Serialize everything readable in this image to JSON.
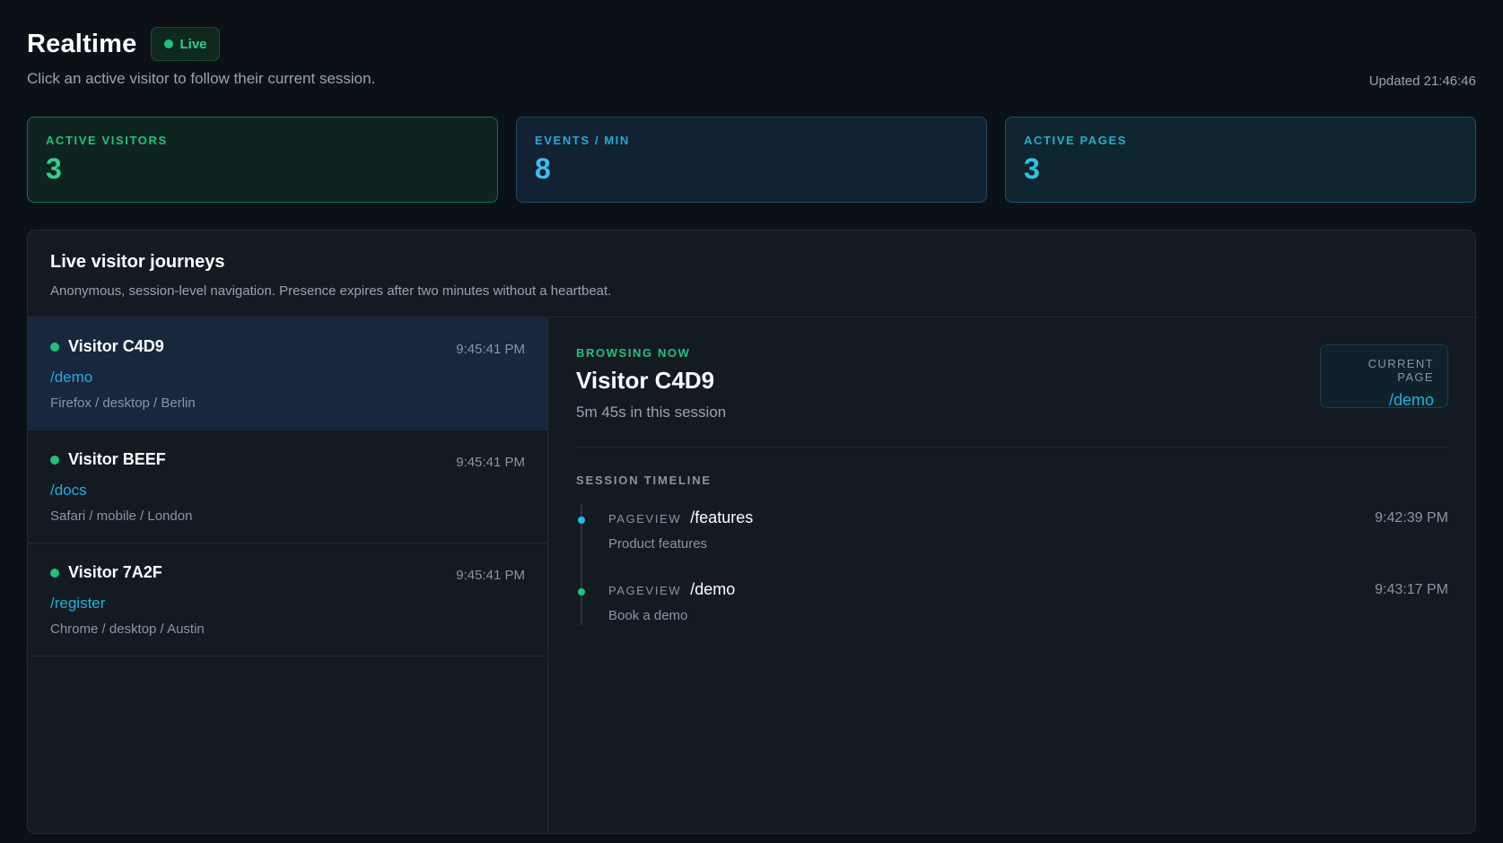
{
  "header": {
    "title": "Realtime",
    "live_badge": "Live",
    "subtitle": "Click an active visitor to follow their current session.",
    "updated": "Updated 21:46:46"
  },
  "stats": [
    {
      "label": "ACTIVE VISITORS",
      "value": "3"
    },
    {
      "label": "EVENTS / MIN",
      "value": "8"
    },
    {
      "label": "ACTIVE PAGES",
      "value": "3"
    }
  ],
  "panel": {
    "title": "Live visitor journeys",
    "description": "Anonymous, session-level navigation. Presence expires after two minutes without a heartbeat."
  },
  "visitors": [
    {
      "name": "Visitor C4D9",
      "time": "9:45:41 PM",
      "path": "/demo",
      "meta": "Firefox / desktop / Berlin",
      "selected": true
    },
    {
      "name": "Visitor BEEF",
      "time": "9:45:41 PM",
      "path": "/docs",
      "meta": "Safari / mobile / London",
      "selected": false
    },
    {
      "name": "Visitor 7A2F",
      "time": "9:45:41 PM",
      "path": "/register",
      "meta": "Chrome / desktop / Austin",
      "selected": false
    }
  ],
  "detail": {
    "status_label": "BROWSING NOW",
    "name": "Visitor C4D9",
    "duration": "5m 45s in this session",
    "current_page_label": "CURRENT PAGE",
    "current_page": "/demo",
    "timeline_label": "SESSION TIMELINE",
    "events": [
      {
        "type": "PAGEVIEW",
        "path": "/features",
        "title": "Product features",
        "time": "9:42:39 PM"
      },
      {
        "type": "PAGEVIEW",
        "path": "/demo",
        "title": "Book a demo",
        "time": "9:43:17 PM"
      }
    ]
  },
  "colors": {
    "live_green": "#22c07b",
    "link_blue": "#22aee0",
    "background": "#0c1118"
  }
}
